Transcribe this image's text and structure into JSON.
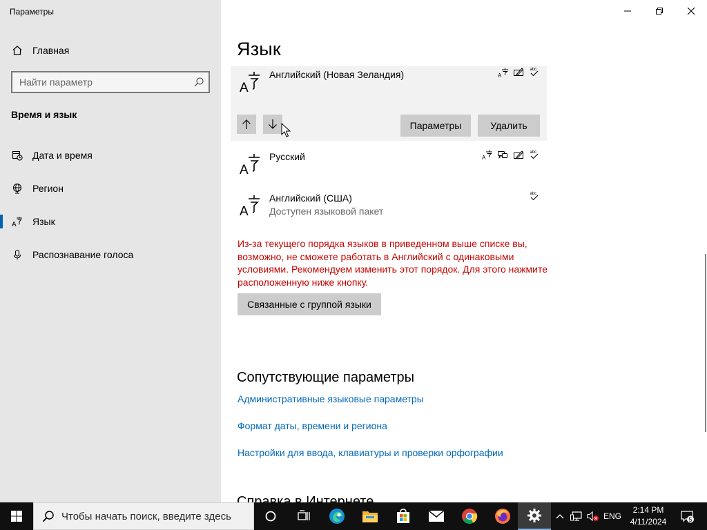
{
  "window": {
    "title": "Параметры",
    "controls": {
      "minimize": "minimize",
      "maximize": "restore",
      "close": "close"
    }
  },
  "sidebar": {
    "home_label": "Главная",
    "search_placeholder": "Найти параметр",
    "section_title": "Время и язык",
    "items": [
      {
        "label": "Дата и время",
        "icon": "date-time-icon",
        "active": false
      },
      {
        "label": "Регион",
        "icon": "globe-icon",
        "active": false
      },
      {
        "label": "Язык",
        "icon": "language-icon",
        "active": true
      },
      {
        "label": "Распознавание голоса",
        "icon": "microphone-icon",
        "active": false
      }
    ]
  },
  "main": {
    "title": "Язык",
    "languages": [
      {
        "name": "Английский (Новая Зеландия)",
        "sub": "",
        "selected": true,
        "features": [
          "display-language",
          "handwriting",
          "spellcheck"
        ]
      },
      {
        "name": "Русский",
        "sub": "",
        "selected": false,
        "features": [
          "display-language",
          "speech",
          "handwriting",
          "spellcheck"
        ]
      },
      {
        "name": "Английский (США)",
        "sub": "Доступен языковой пакет",
        "selected": false,
        "features": [
          "spellcheck"
        ]
      }
    ],
    "buttons": {
      "move_up": "↑",
      "move_down": "↓",
      "options": "Параметры",
      "remove": "Удалить",
      "grouped_languages": "Связанные с группой языки"
    },
    "warning": "Из-за текущего порядка языков в приведенном выше списке вы, возможно, не сможете работать в Английский с одинаковыми условиями. Рекомендуем изменить этот порядок. Для этого нажмите расположенную ниже кнопку.",
    "related_title": "Сопутствующие параметры",
    "related_links": [
      "Административные языковые параметры",
      "Формат даты, времени и региона",
      "Настройки для ввода, клавиатуры и проверки орфографии"
    ],
    "help_title": "Справка в Интернете"
  },
  "taskbar": {
    "search_placeholder": "Чтобы начать поиск, введите здесь",
    "apps": [
      "cortana",
      "task-view",
      "edge",
      "file-explorer",
      "store",
      "mail",
      "chrome",
      "firefox",
      "settings"
    ],
    "input_language": "ENG",
    "time": "2:14 PM",
    "date": "4/11/2024",
    "notification_count": "5"
  },
  "colors": {
    "accent": "#0063b1",
    "link": "#0067b8",
    "warning": "#c50500",
    "sidebar_bg": "#e6e6e6",
    "selected_bg": "#f2f2f2",
    "button_bg": "#cccccc",
    "taskbar_bg": "#101010"
  }
}
